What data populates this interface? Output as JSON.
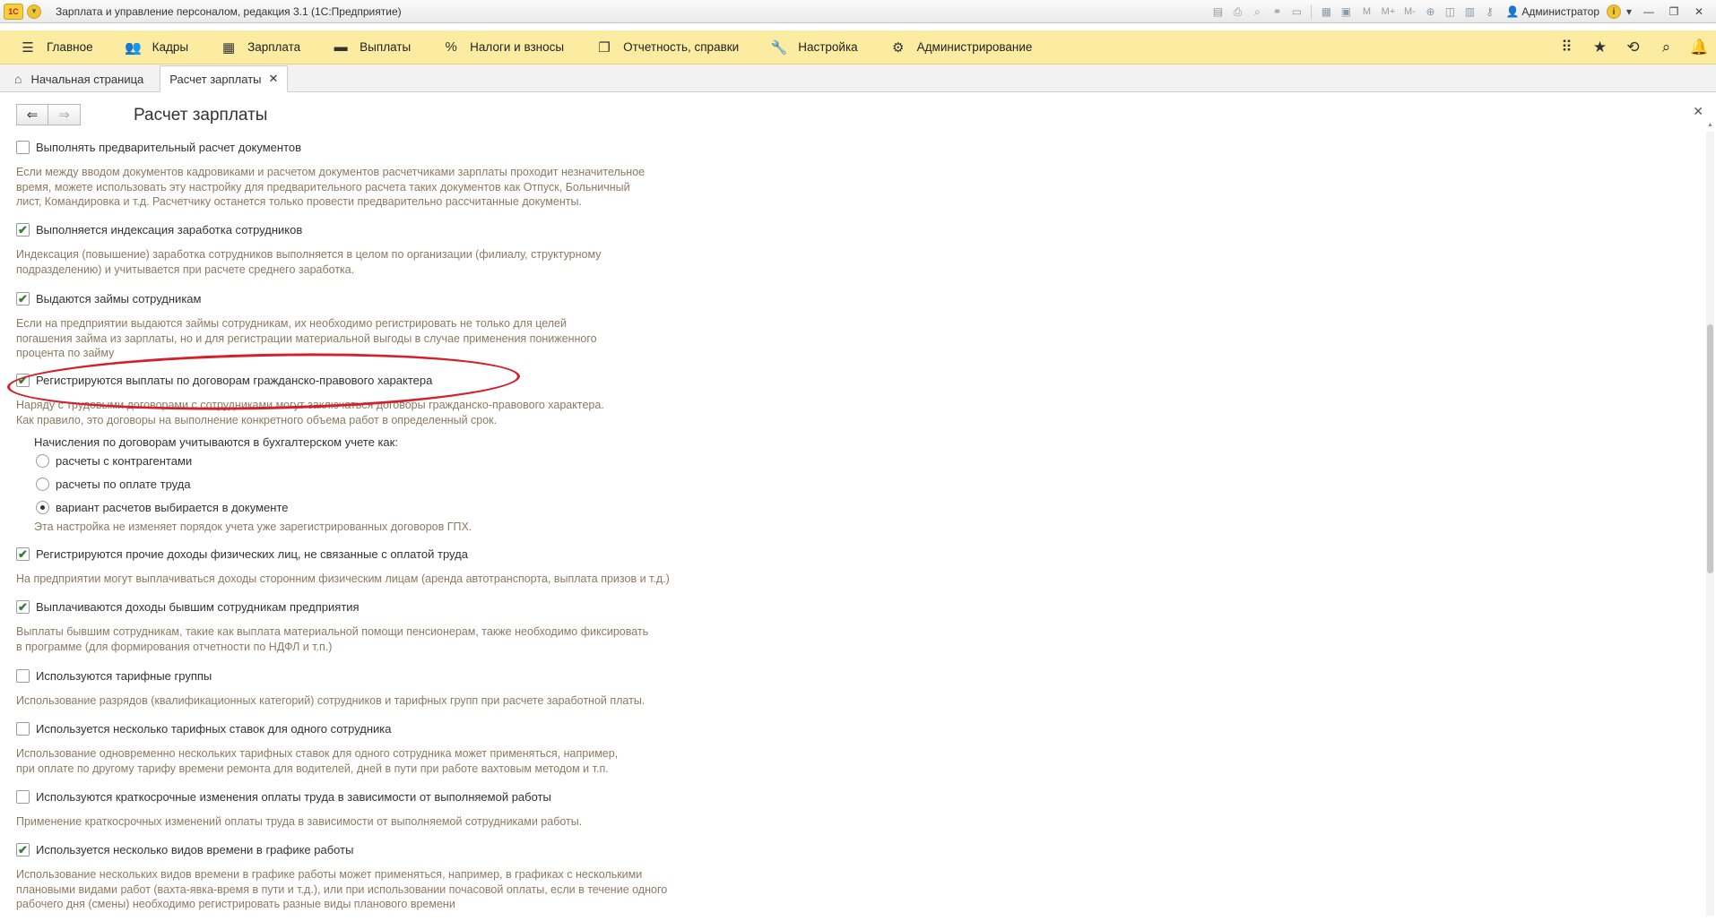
{
  "window": {
    "title": "Зарплата и управление персоналом, редакция 3.1  (1С:Предприятие)",
    "logo_text": "1С",
    "user": "Администратор",
    "zoom_labels": [
      "M",
      "M+",
      "M-"
    ]
  },
  "sections": [
    {
      "label": "Главное",
      "icon": "hamburger-icon"
    },
    {
      "label": "Кадры",
      "icon": "people-icon"
    },
    {
      "label": "Зарплата",
      "icon": "calculator-icon"
    },
    {
      "label": "Выплаты",
      "icon": "wallet-icon"
    },
    {
      "label": "Налоги и взносы",
      "icon": "percent-icon"
    },
    {
      "label": "Отчетность, справки",
      "icon": "reports-icon"
    },
    {
      "label": "Настройка",
      "icon": "wrench-icon"
    },
    {
      "label": "Администрирование",
      "icon": "gear-icon"
    }
  ],
  "tabs": [
    {
      "label": "Начальная страница",
      "icon": "home-icon"
    },
    {
      "label": "Расчет зарплаты",
      "active": true
    }
  ],
  "form": {
    "title": "Расчет зарплаты",
    "options": [
      {
        "label": "Выполнять предварительный расчет документов",
        "checked": false,
        "desc": [
          "Если между вводом документов кадровиками и расчетом документов расчетчиками зарплаты проходит незначительное",
          "время, можете использовать эту настройку для предварительного расчета таких документов как Отпуск, Больничный",
          "лист, Командировка и т.д. Расчетчику останется только провести предварительно рассчитанные документы."
        ]
      },
      {
        "label": "Выполняется индексация заработка сотрудников",
        "checked": true,
        "desc": [
          "Индексация (повышение) заработка сотрудников выполняется в целом по организации (филиалу, структурному",
          "подразделению) и учитывается при расчете среднего заработка."
        ]
      },
      {
        "label": "Выдаются займы сотрудникам",
        "checked": true,
        "desc": [
          "Если на предприятии выдаются займы сотрудникам, их необходимо регистрировать не только для целей",
          "погашения займа из зарплаты, но и для регистрации материальной выгоды в случае применения пониженного",
          "процента по займу"
        ]
      },
      {
        "label": "Регистрируются выплаты по договорам гражданско-правового характера",
        "checked": true,
        "desc": [
          "Наряду с трудовыми договорами с сотрудниками могут заключаться договоры гражданско-правового характера.",
          "Как правило, это договоры на выполнение конкретного объема работ в определенный срок."
        ]
      },
      {
        "label": "Регистрируются прочие доходы физических лиц, не связанные с оплатой труда",
        "checked": true,
        "desc": [
          "На предприятии могут выплачиваться доходы сторонним физическим лицам (аренда автотранспорта, выплата призов и т.д.)"
        ]
      },
      {
        "label": "Выплачиваются доходы бывшим сотрудникам предприятия",
        "checked": true,
        "desc": [
          "Выплаты бывшим сотрудникам, такие как выплата материальной помощи пенсионерам, также необходимо фиксировать",
          "в программе (для формирования отчетности по НДФЛ и т.п.)"
        ]
      },
      {
        "label": "Используются тарифные группы",
        "checked": false,
        "desc": [
          "Использование разрядов (квалификационных категорий) сотрудников и тарифных групп при расчете заработной платы."
        ]
      },
      {
        "label": "Используется несколько тарифных ставок для одного сотрудника",
        "checked": false,
        "desc": [
          "Использование одновременно нескольких тарифных ставок для одного сотрудника может применяться, например,",
          "при оплате по другому тарифу времени ремонта для водителей, дней в пути при работе вахтовым методом и т.п."
        ]
      },
      {
        "label": "Используются краткосрочные изменения оплаты труда в зависимости от выполняемой работы",
        "checked": false,
        "desc": [
          "Применение краткосрочных изменений оплаты труда в зависимости от выполняемой сотрудниками работы."
        ]
      },
      {
        "label": "Используется несколько видов времени в графике работы",
        "checked": true,
        "desc": [
          "Использование нескольких видов времени в графике работы может применяться, например, в графиках с несколькими",
          "плановыми видами работ (вахта-явка-время в пути и т.д.), или при использовании почасовой оплаты, если в течение одного",
          "рабочего дня (смены) необходимо регистрировать разные виды планового времени"
        ]
      }
    ],
    "gph_accounting": {
      "caption": "Начисления по договорам учитываются в бухгалтерском учете как:",
      "choices": [
        "расчеты с контрагентами",
        "расчеты по оплате труда",
        "вариант расчетов выбирается в документе"
      ],
      "selected_index": 2,
      "note": "Эта настройка не изменяет порядок учета уже зарегистрированных договоров ГПХ."
    }
  },
  "colors": {
    "section_bg": "#fbeca1",
    "description_text": "#8b7a63",
    "highlight": "#d4202a"
  }
}
